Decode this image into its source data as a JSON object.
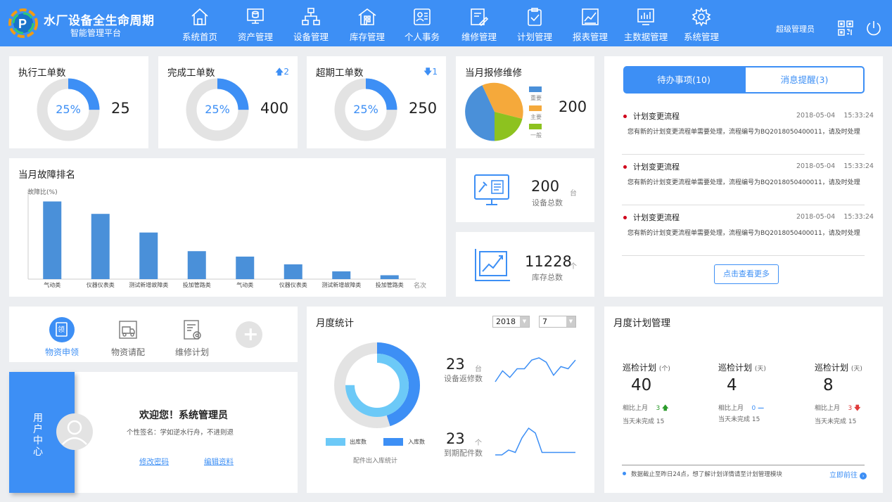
{
  "brand": {
    "title": "水厂设备全生命周期",
    "subtitle": "智能管理平台"
  },
  "nav": [
    {
      "label": "系统首页",
      "icon": "home-icon"
    },
    {
      "label": "资产管理",
      "icon": "asset-icon"
    },
    {
      "label": "设备管理",
      "icon": "org-chart-icon"
    },
    {
      "label": "库存管理",
      "icon": "warehouse-icon"
    },
    {
      "label": "个人事务",
      "icon": "personal-icon"
    },
    {
      "label": "维修管理",
      "icon": "repair-icon"
    },
    {
      "label": "计划管理",
      "icon": "clipboard-icon"
    },
    {
      "label": "报表管理",
      "icon": "report-icon"
    },
    {
      "label": "主数据管理",
      "icon": "data-chart-icon"
    },
    {
      "label": "系统管理",
      "icon": "gear-icon"
    }
  ],
  "user": {
    "name": "超级管理员"
  },
  "kpis": [
    {
      "title": "执行工单数",
      "percent": "25%",
      "value": "25",
      "trend": "",
      "fraction": 0.25
    },
    {
      "title": "完成工单数",
      "percent": "25%",
      "value": "400",
      "trend": "2",
      "trend_dir": "up",
      "fraction": 0.25
    },
    {
      "title": "超期工单数",
      "percent": "25%",
      "value": "250",
      "trend": "1",
      "trend_dir": "down",
      "fraction": 0.25
    }
  ],
  "repair": {
    "title": "当月报修维修",
    "value": "200",
    "legend": [
      {
        "label": "重要",
        "color": "#4a90d9"
      },
      {
        "label": "主要",
        "color": "#f5a93b"
      },
      {
        "label": "一般",
        "color": "#8dc21f"
      }
    ]
  },
  "chart_data": {
    "type": "bar",
    "title": "当月故障排名",
    "ylabel": "故障比(%)",
    "xlabel": "名次",
    "categories": [
      "气动类",
      "仪器仪表类",
      "测试新增故障类",
      "投加管路类",
      "气动类",
      "仪器仪表类",
      "测试新增故障类",
      "投加管路类"
    ],
    "values": [
      100,
      84,
      60,
      36,
      29,
      19,
      10,
      5
    ],
    "ylim": [
      0,
      105
    ],
    "color": "#4a90d9",
    "grid": false
  },
  "devices": {
    "value": "200",
    "unit": "台",
    "label": "设备总数"
  },
  "stock": {
    "value": "11228",
    "unit": "个",
    "label": "库存总数"
  },
  "todo": {
    "tab_active": "待办事项(10)",
    "tab_inactive": "消息提醒(3)",
    "items": [
      {
        "title": "计划变更流程",
        "date": "2018-05-04",
        "time": "15:33:24",
        "desc": "您有新的计划变更流程单需要处理，流程编号为BQ2018050400011，请及时处理"
      },
      {
        "title": "计划变更流程",
        "date": "2018-05-04",
        "time": "15:33:24",
        "desc": "您有新的计划变更流程单需要处理，流程编号为BQ2018050400011，请及时处理"
      },
      {
        "title": "计划变更流程",
        "date": "2018-05-04",
        "time": "15:33:24",
        "desc": "您有新的计划变更流程单需要处理，流程编号为BQ2018050400011，请及时处理"
      }
    ],
    "more": "点击查看更多"
  },
  "quick": [
    {
      "label": "物资申领",
      "icon": "apply-icon",
      "active": true
    },
    {
      "label": "物资请配",
      "icon": "truck-icon",
      "active": false
    },
    {
      "label": "维修计划",
      "icon": "plan-gear-icon",
      "active": false
    },
    {
      "label": "",
      "icon": "add-icon",
      "active": false
    }
  ],
  "profile": {
    "side_label": "用户中心",
    "welcome": "欢迎您！系统管理员",
    "signature": "个性签名：学如逆水行舟，不进则退",
    "change_password": "修改密码",
    "edit_profile": "编辑资料"
  },
  "monthly": {
    "title": "月度统计",
    "year": "2018",
    "month": "7",
    "donut_caption": "配件出入库统计",
    "legend_out": "出库数",
    "legend_in": "入库数",
    "out_fraction": 0.75,
    "in_fraction": 0.45,
    "stat1": {
      "value": "23",
      "unit": "台",
      "label": "设备返修数",
      "trend": [
        4,
        9,
        6,
        10,
        10,
        14,
        15,
        13,
        7,
        11,
        10,
        14
      ]
    },
    "stat2": {
      "value": "23",
      "unit": "个",
      "label": "到期配件数",
      "trend": [
        3,
        3,
        5,
        4,
        10,
        14,
        12,
        4,
        4,
        4,
        4,
        4,
        4
      ]
    }
  },
  "plan": {
    "title": "月度计划管理",
    "items": [
      {
        "name": "巡检计划",
        "unit": "(个)",
        "value": "40",
        "compare_label": "相比上月",
        "compare_value": "3",
        "compare_dir": "up",
        "todo": "当天未完成 15"
      },
      {
        "name": "巡检计划",
        "unit": "(天)",
        "value": "4",
        "compare_label": "相比上月",
        "compare_value": "0",
        "compare_dir": "flat",
        "todo": "当天未完成 15"
      },
      {
        "name": "巡检计划",
        "unit": "(天)",
        "value": "8",
        "compare_label": "相比上月",
        "compare_value": "3",
        "compare_dir": "down",
        "todo": "当天未完成 15"
      }
    ],
    "footer_note": "数据截止至昨日24点，想了解计划详情请至计划管理模块",
    "footer_link": "立即前往"
  },
  "colors": {
    "primary": "#3d8ff5",
    "donut_track": "#e3e3e3",
    "up": "#2b9b2b",
    "down": "#e03a3a",
    "light_blue": "#6cc9f7"
  }
}
